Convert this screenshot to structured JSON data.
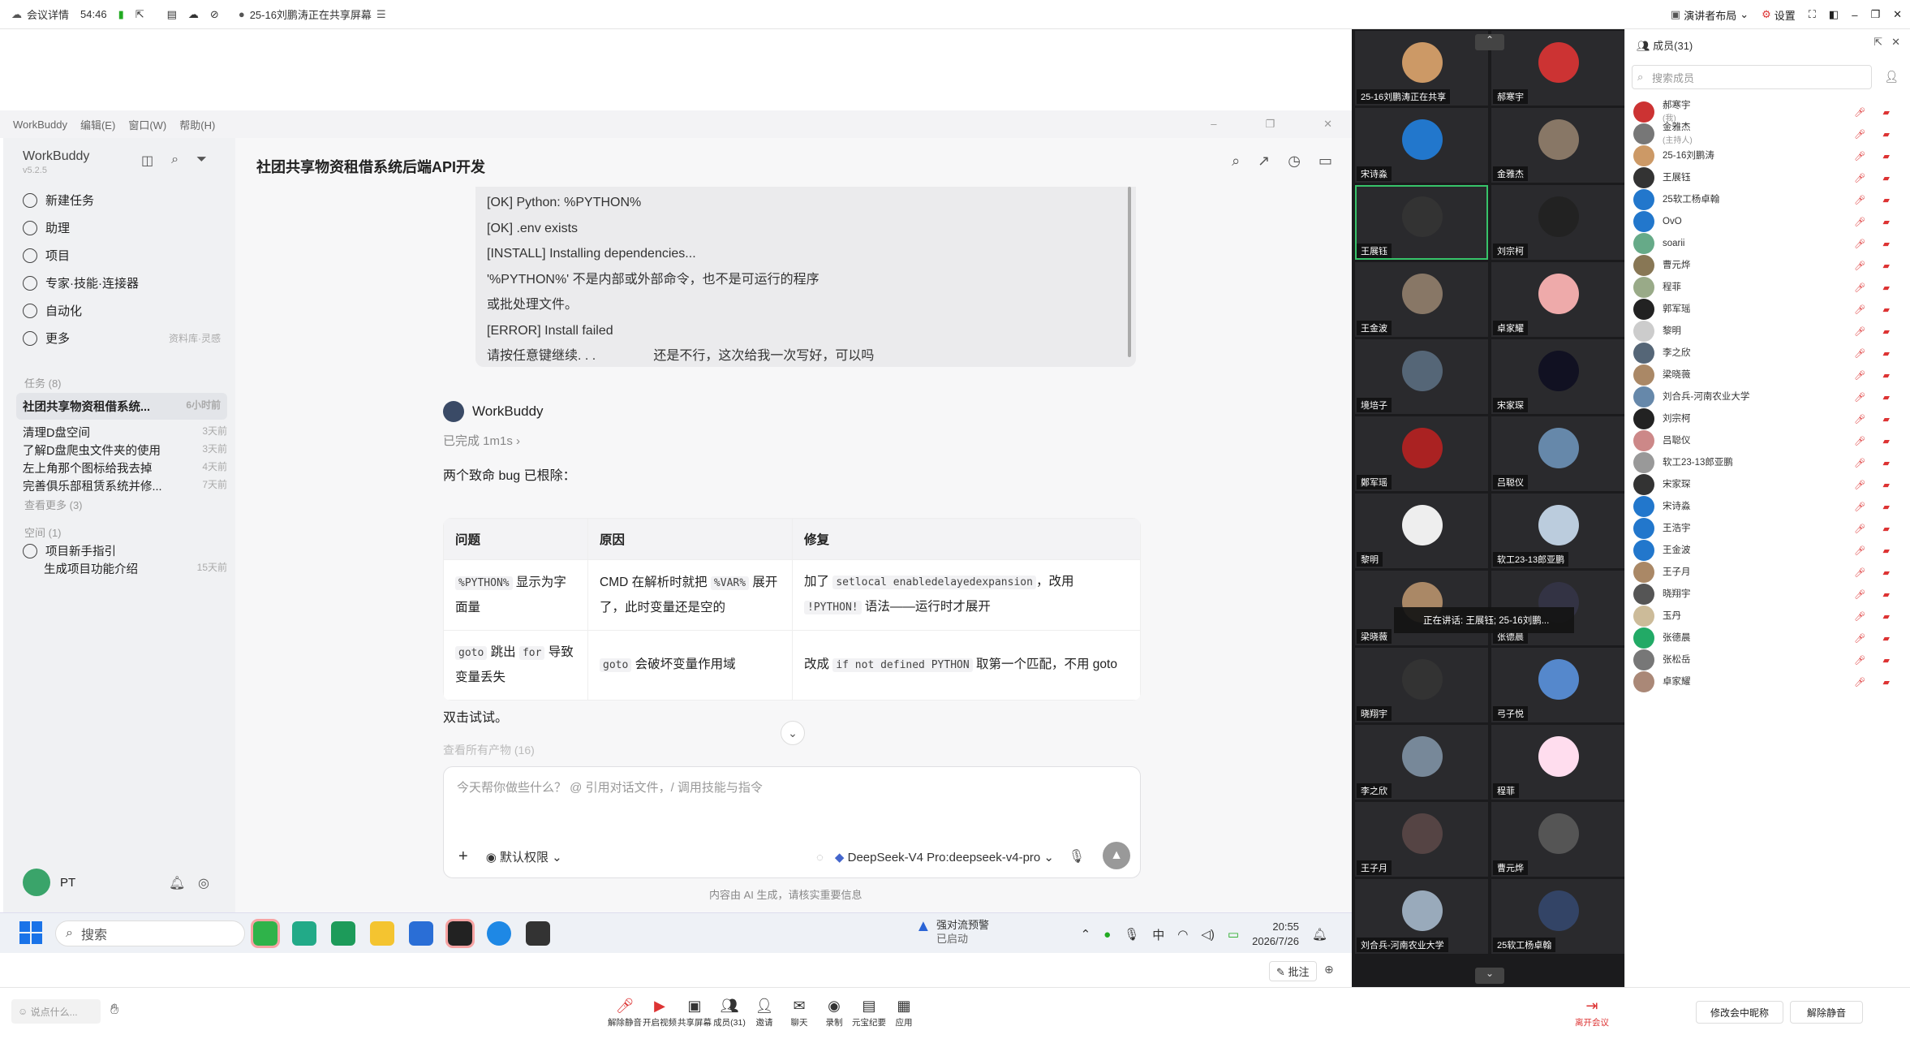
{
  "meeting": {
    "title_label": "会议详情",
    "duration": "54:46",
    "sharing_notice": "25-16刘鹏涛正在共享屏幕",
    "layout_label": "演讲者布局",
    "settings_label": "设置"
  },
  "workbuddy": {
    "window_title": "WorkBuddy",
    "menu": [
      "编辑(E)",
      "窗口(W)",
      "帮助(H)"
    ],
    "brand": "WorkBuddy",
    "version": "v5.2.5",
    "nav": [
      {
        "label": "新建任务",
        "icon": "plus-circle-icon"
      },
      {
        "label": "助理",
        "icon": "assistant-icon"
      },
      {
        "label": "项目",
        "icon": "project-icon"
      },
      {
        "label": "专家·技能·连接器",
        "icon": "expert-icon"
      },
      {
        "label": "自动化",
        "icon": "automation-icon"
      },
      {
        "label": "更多",
        "icon": "more-icon"
      }
    ],
    "more_hint": "资料库·灵感",
    "tasks_header": "任务 (8)",
    "tasks": [
      {
        "title": "社团共享物资租借系统...",
        "time": "6小时前"
      },
      {
        "title": "清理D盘空间",
        "time": "3天前"
      },
      {
        "title": "了解D盘爬虫文件夹的使用",
        "time": "3天前"
      },
      {
        "title": "左上角那个图标给我去掉",
        "time": "4天前"
      },
      {
        "title": "完善俱乐部租赁系统并修...",
        "time": "7天前"
      }
    ],
    "see_more": "查看更多 (3)",
    "space_header": "空间 (1)",
    "project_guide": "项目新手指引",
    "subproject": {
      "title": "生成项目功能介绍",
      "time": "15天前"
    },
    "user_name": "PT",
    "chat_title": "社团共享物资租借系统后端API开发",
    "log_lines": [
      "[OK] Python: %PYTHON%",
      "[OK] .env exists",
      "[INSTALL] Installing dependencies...",
      "'%PYTHON%' 不是内部或外部命令，也不是可运行的程序",
      "或批处理文件。",
      "[ERROR] Install failed",
      "请按任意键继续. . .                还是不行，这次给我一次写好，可以吗"
    ],
    "assistant_name": "WorkBuddy",
    "completed": "已完成 1m1s",
    "fixed_text": "两个致命 bug 已根除：",
    "table_headers": [
      "问题",
      "原因",
      "修复"
    ],
    "try_text": "双击试试。",
    "view_all": "查看所有产物 (16)",
    "input_placeholder": "今天帮你做些什么？ @ 引用对话文件，/ 调用技能与指令",
    "permission": "默认权限",
    "model": "DeepSeek-V4 Pro:deepseek-v4-pro",
    "disclaimer": "内容由 AI 生成，请核实重要信息"
  },
  "taskbar": {
    "search": "搜索",
    "alert_title": "强对流预警",
    "alert_sub": "已启动",
    "ime": "中",
    "time": "20:55",
    "date": "2026/7/26",
    "annotate": "批注"
  },
  "video_tiles": [
    "25-16刘鹏涛正在共享",
    "郝寒宇",
    "宋诗淼",
    "金雅杰",
    "王展钰",
    "刘宗柯",
    "王金波",
    "卓家耀",
    "境培子",
    "宋家琛",
    "鄭军瑶",
    "吕聪仪",
    "黎明",
    "软工23-13郎亚鹏",
    "梁晓薇",
    "张德晨",
    "晓翔宇",
    "弓子悦",
    "李之欣",
    "程菲",
    "王子月",
    "曹元烨",
    "刘合兵-河南农业大学",
    "25软工杨卓翰"
  ],
  "speaking_now": "正在讲话: 王展钰; 25-16刘鹏...",
  "members": {
    "header": "成员(31)",
    "search_placeholder": "搜索成员",
    "list": [
      {
        "name": "郝寒宇",
        "sub": "(我)"
      },
      {
        "name": "金雅杰",
        "sub": "(主持人)"
      },
      {
        "name": "25-16刘鹏涛",
        "sub": ""
      },
      {
        "name": "王展钰",
        "sub": ""
      },
      {
        "name": "25软工杨卓翰",
        "sub": ""
      },
      {
        "name": "OvO",
        "sub": ""
      },
      {
        "name": "soarii",
        "sub": ""
      },
      {
        "name": "曹元烨",
        "sub": ""
      },
      {
        "name": "程菲",
        "sub": ""
      },
      {
        "name": "郭军瑶",
        "sub": ""
      },
      {
        "name": "黎明",
        "sub": ""
      },
      {
        "name": "李之欣",
        "sub": ""
      },
      {
        "name": "梁晓薇",
        "sub": ""
      },
      {
        "name": "刘合兵-河南农业大学",
        "sub": ""
      },
      {
        "name": "刘宗柯",
        "sub": ""
      },
      {
        "name": "吕聪仪",
        "sub": ""
      },
      {
        "name": "软工23-13郎亚鹏",
        "sub": ""
      },
      {
        "name": "宋家琛",
        "sub": ""
      },
      {
        "name": "宋诗淼",
        "sub": ""
      },
      {
        "name": "王浩宇",
        "sub": ""
      },
      {
        "name": "王金波",
        "sub": ""
      },
      {
        "name": "王子月",
        "sub": ""
      },
      {
        "name": "晓翔宇",
        "sub": ""
      },
      {
        "name": "玉丹",
        "sub": ""
      },
      {
        "name": "张德晨",
        "sub": ""
      },
      {
        "name": "张松岳",
        "sub": ""
      },
      {
        "name": "卓家耀",
        "sub": ""
      }
    ],
    "rename_btn": "修改会中昵称",
    "unmute_btn": "解除静音"
  },
  "toolbar": {
    "chat_placeholder": "说点什么...",
    "buttons": [
      "解除静音",
      "开启视频",
      "共享屏幕",
      "成员(31)",
      "邀请",
      "聊天",
      "录制",
      "元宝纪要",
      "应用"
    ],
    "leave": "离开会议"
  }
}
